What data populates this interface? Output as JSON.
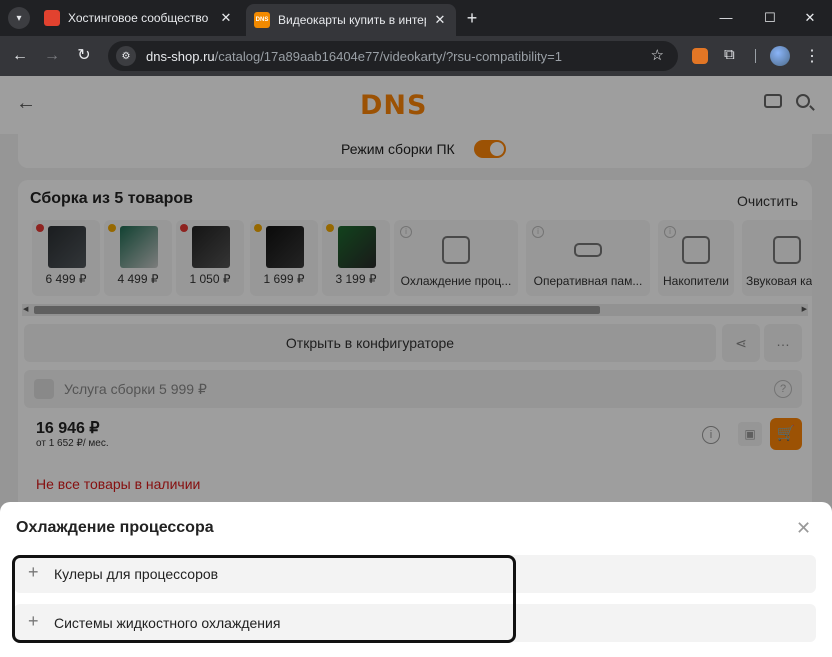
{
  "browser": {
    "tabs": [
      {
        "title": "Хостинговое сообщество «Timeweb»",
        "favicon": "timeweb-favicon"
      },
      {
        "title": "Видеокарты купить в интернет-магазине",
        "favicon": "dns-favicon",
        "favicon_text": "DNS"
      }
    ],
    "url_host": "dns-shop.ru",
    "url_path": "/catalog/17a89aab16404e77/videokarty/?rsu-compatibility=1"
  },
  "site": {
    "logo": "DNS",
    "brand_color": "#fc8507"
  },
  "mode": {
    "label": "Режим сборки ПК",
    "enabled": true
  },
  "build": {
    "title": "Сборка из 5 товаров",
    "clear_label": "Очистить",
    "products": [
      {
        "price": "6 499 ₽",
        "status_color": "#e53935",
        "icon": "motherboard-image"
      },
      {
        "price": "4 499 ₽",
        "status_color": "#f2a900",
        "icon": "cpu-image"
      },
      {
        "price": "1 050 ₽",
        "status_color": "#e53935",
        "icon": "psu-image"
      },
      {
        "price": "1 699 ₽",
        "status_color": "#f2a900",
        "icon": "case-image"
      },
      {
        "price": "3 199 ₽",
        "status_color": "#f2a900",
        "icon": "gpu-image"
      }
    ],
    "categories": [
      {
        "label": "Охлаждение проц...",
        "icon": "fan-icon"
      },
      {
        "label": "Оперативная пам...",
        "icon": "ram-icon"
      },
      {
        "label": "Накопители",
        "icon": "disk-icon"
      },
      {
        "label": "Звуковая ка",
        "icon": "soundcard-icon"
      }
    ],
    "open_configurator": "Открыть в конфигураторе",
    "service_label": "Услуга сборки 5 999 ₽",
    "total": "16 946 ₽",
    "credit": "от 1 652 ₽/ мес.",
    "notice": "Не все товары в наличии"
  },
  "sheet": {
    "title": "Охлаждение процессора",
    "items": [
      {
        "label": "Кулеры для процессоров"
      },
      {
        "label": "Системы жидкостного охлаждения"
      }
    ]
  }
}
